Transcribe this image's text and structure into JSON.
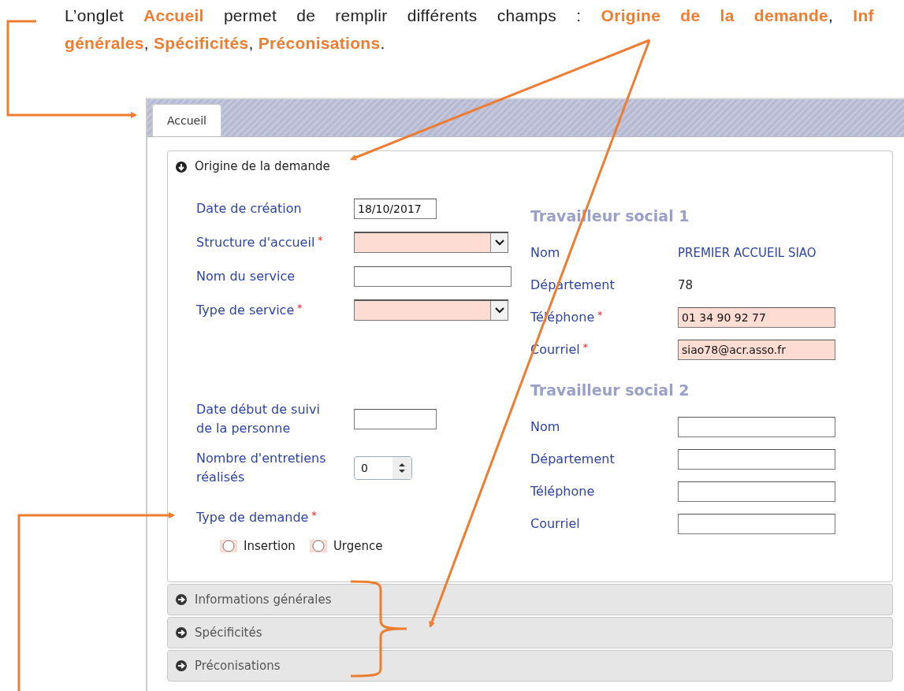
{
  "caption": {
    "lines": [
      "L’onglet **Accueil** permet de remplir différents champs : **Origine de la demande**, **Inf**",
      "**générales**, **Spécificités**, **Préconisations**."
    ]
  },
  "tabs": [
    {
      "label": "Accueil",
      "selected": true
    }
  ],
  "sections": [
    {
      "title": "Origine de la demande",
      "expanded": true
    },
    {
      "title": "Informations générales",
      "expanded": false
    },
    {
      "title": "Spécificités",
      "expanded": false
    },
    {
      "title": "Préconisations",
      "expanded": false
    }
  ],
  "origin": {
    "fields": [
      {
        "label": "Date de création",
        "kind": "text",
        "value": "18/10/2017"
      },
      {
        "label": "Structure d'accueil",
        "required_mark": "*",
        "kind": "select"
      },
      {
        "label": "Nom du service",
        "kind": "text"
      },
      {
        "label": "Type de service",
        "required_mark": "*",
        "kind": "select"
      }
    ],
    "lower_fields": [
      {
        "label": "Date début de suivi de la personne",
        "kind": "text"
      },
      {
        "label": "Nombre d'entretiens réalisés",
        "kind": "number",
        "value": "0"
      }
    ],
    "request_type": {
      "label": "Type de demande",
      "required_mark": "*",
      "options": [
        {
          "label": "Insertion",
          "selected": false
        },
        {
          "label": "Urgence",
          "selected": false
        }
      ]
    }
  },
  "workers": [
    {
      "title": "Travailleur social 1",
      "fields": [
        {
          "label": "Nom",
          "kind": "display",
          "value": "PREMIER ACCUEIL SIAO"
        },
        {
          "label": "Département",
          "kind": "plain",
          "value": "78"
        },
        {
          "label": "Téléphone",
          "required_mark": "*",
          "kind": "text",
          "value": "01 34 90 92 77"
        },
        {
          "label": "Courriel",
          "required_mark": "*",
          "kind": "text",
          "value": "siao78@acr.asso.fr"
        }
      ]
    },
    {
      "title": "Travailleur social 2",
      "fields": [
        {
          "label": "Nom",
          "kind": "text"
        },
        {
          "label": "Département",
          "kind": "text"
        },
        {
          "label": "Téléphone",
          "kind": "text"
        },
        {
          "label": "Courriel",
          "kind": "text"
        }
      ]
    }
  ]
}
